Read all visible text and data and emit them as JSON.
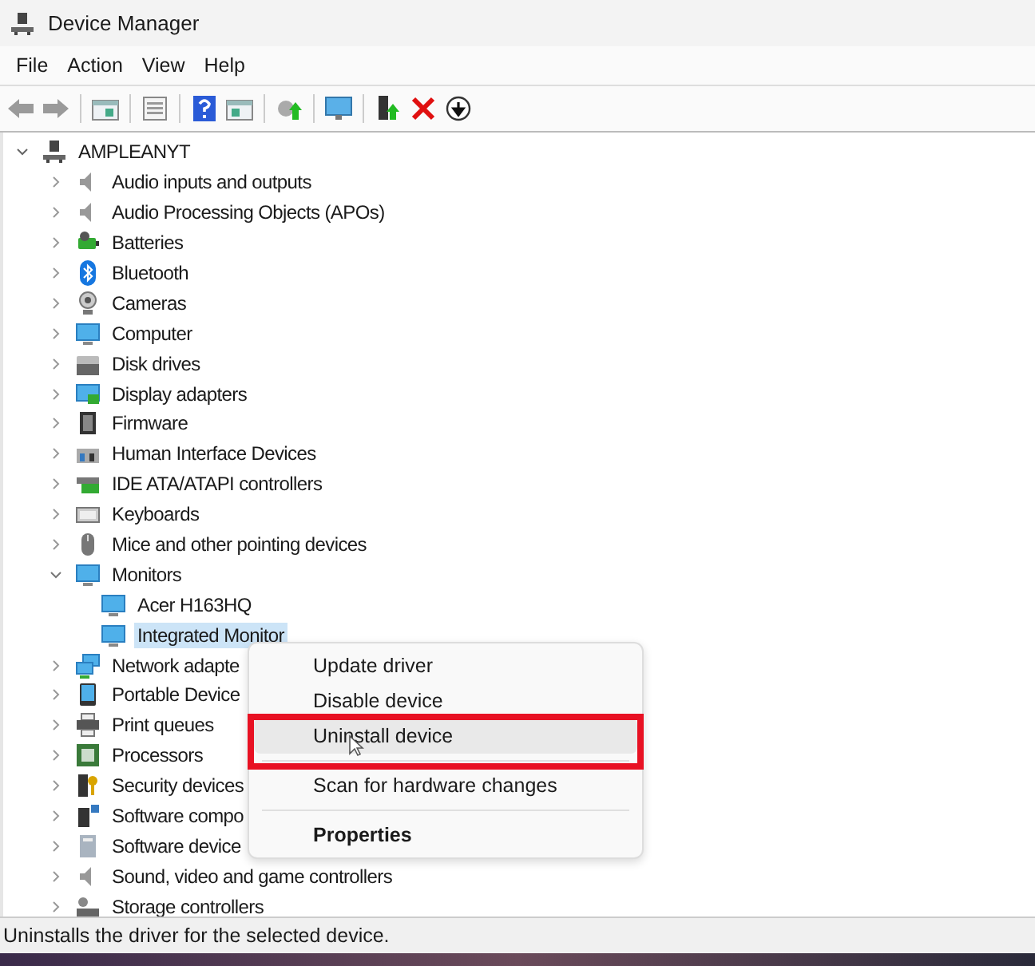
{
  "window": {
    "title": "Device Manager"
  },
  "menu_bar": [
    "File",
    "Action",
    "View",
    "Help"
  ],
  "tree": {
    "label": "AMPLEANYT",
    "expanded": true,
    "children": [
      {
        "label": "Audio inputs and outputs",
        "expanded": false,
        "selected": false
      },
      {
        "label": "Audio Processing Objects (APOs)",
        "expanded": false,
        "selected": false
      },
      {
        "label": "Batteries",
        "expanded": false,
        "selected": false
      },
      {
        "label": "Bluetooth",
        "expanded": false,
        "selected": false
      },
      {
        "label": "Cameras",
        "expanded": false,
        "selected": false
      },
      {
        "label": "Computer",
        "expanded": false,
        "selected": false
      },
      {
        "label": "Disk drives",
        "expanded": false,
        "selected": false
      },
      {
        "label": "Display adapters",
        "expanded": false,
        "selected": false
      },
      {
        "label": "Firmware",
        "expanded": false,
        "selected": false
      },
      {
        "label": "Human Interface Devices",
        "expanded": false,
        "selected": false
      },
      {
        "label": "IDE ATA/ATAPI controllers",
        "expanded": false,
        "selected": false
      },
      {
        "label": "Keyboards",
        "expanded": false,
        "selected": false
      },
      {
        "label": "Mice and other pointing devices",
        "expanded": false,
        "selected": false
      },
      {
        "label": "Monitors",
        "expanded": true,
        "selected": false,
        "children": [
          {
            "label": "Acer H163HQ",
            "selected": false
          },
          {
            "label": "Integrated Monitor",
            "selected": true
          }
        ]
      },
      {
        "label": "Network adapte",
        "expanded": false,
        "selected": false
      },
      {
        "label": "Portable Device",
        "expanded": false,
        "selected": false
      },
      {
        "label": "Print queues",
        "expanded": false,
        "selected": false
      },
      {
        "label": "Processors",
        "expanded": false,
        "selected": false
      },
      {
        "label": "Security devices",
        "expanded": false,
        "selected": false
      },
      {
        "label": "Software compo",
        "expanded": false,
        "selected": false
      },
      {
        "label": "Software device",
        "expanded": false,
        "selected": false
      },
      {
        "label": "Sound, video and game controllers",
        "expanded": false,
        "selected": false
      },
      {
        "label": "Storage controllers",
        "expanded": false,
        "selected": false
      }
    ]
  },
  "context_menu": [
    {
      "kind": "item",
      "label": "Update driver",
      "selected": false
    },
    {
      "kind": "item",
      "label": "Disable device",
      "selected": false
    },
    {
      "kind": "item",
      "label": "Uninstall device",
      "selected": true
    },
    {
      "kind": "separator"
    },
    {
      "kind": "item",
      "label": "Scan for hardware changes",
      "selected": false
    },
    {
      "kind": "separator"
    },
    {
      "kind": "default",
      "label": "Properties",
      "selected": false
    }
  ],
  "status_bar": "Uninstalls the driver for the selected device."
}
